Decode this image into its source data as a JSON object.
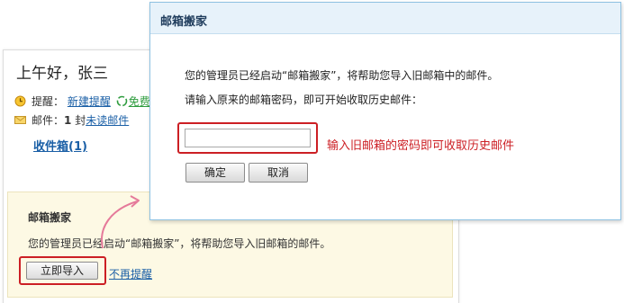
{
  "page": {
    "greeting": "上午好，张三",
    "reminder": {
      "label": "提醒：",
      "new_reminder_link": "新建提醒",
      "free_link": "免费"
    },
    "mail": {
      "label": "邮件：",
      "count": "1",
      "unit": "封",
      "unread_link": "未读邮件"
    },
    "inbox_link": "收件箱(1)"
  },
  "notice": {
    "title": "邮箱搬家",
    "text": "您的管理员已经启动“邮箱搬家”，将帮助您导入旧邮箱的邮件。",
    "import_button": "立即导入",
    "dismiss_link": "不再提醒"
  },
  "dialog": {
    "title": "邮箱搬家",
    "line1": "您的管理员已经启动“邮箱搬家”，将帮助您导入旧邮箱中的邮件。",
    "line2": "请输入原来的邮箱密码，即可开始收取历史邮件：",
    "password_value": "",
    "hint": "输入旧邮箱的密码即可收取历史邮件",
    "ok_button": "确定",
    "cancel_button": "取消"
  },
  "colors": {
    "link": "#1a5fa6",
    "highlight": "#cc1f24",
    "notice_bg": "#fdf9e4",
    "dialog_header_bg": "#e7f2fa",
    "arrow": "#e57a9a"
  },
  "icons": {
    "reminder": "clock-icon",
    "mail": "envelope-icon",
    "free": "recycle-icon",
    "arrow": "curved-arrow-icon"
  }
}
